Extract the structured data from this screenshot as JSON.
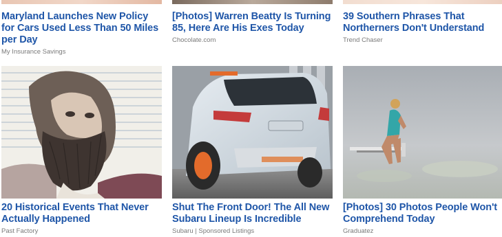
{
  "feed": {
    "top_row": [
      {
        "headline": "Maryland Launches New Policy for Cars Used Less Than 50 Miles per Day",
        "source": "My Insurance Savings"
      },
      {
        "headline": "[Photos] Warren Beatty Is Turning 85, Here Are His Exes Today",
        "source": "Chocolate.com"
      },
      {
        "headline": "39 Southern Phrases That Northerners Don't Understand",
        "source": "Trend Chaser"
      }
    ],
    "bottom_row": [
      {
        "headline": "20 Historical Events That Never Actually Happened",
        "source": "Past Factory"
      },
      {
        "headline": "Shut The Front Door! The All New Subaru Lineup Is Incredible",
        "source": "Subaru | Sponsored Listings"
      },
      {
        "headline": "[Photos] 30 Photos People Won't Comprehend Today",
        "source": "Graduatez"
      }
    ]
  },
  "colors": {
    "headline": "#1f56a8",
    "source": "#7a7a7a"
  }
}
